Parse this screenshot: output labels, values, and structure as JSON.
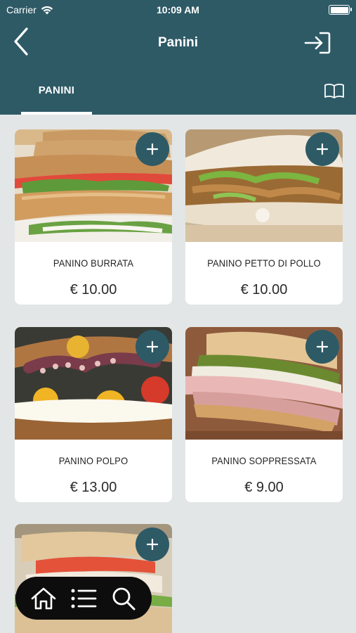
{
  "status_bar": {
    "carrier": "Carrier",
    "time": "10:09 AM"
  },
  "header": {
    "title": "Panini"
  },
  "tabs": [
    {
      "label": "PANINI",
      "active": true
    }
  ],
  "products": [
    {
      "name": "PANINO BURRATA",
      "price": "€ 10.00"
    },
    {
      "name": "PANINO PETTO DI POLLO",
      "price": "€ 10.00"
    },
    {
      "name": "PANINO POLPO",
      "price": "€ 13.00"
    },
    {
      "name": "PANINO SOPPRESSATA",
      "price": "€ 9.00"
    },
    {
      "name": "",
      "price": ""
    }
  ],
  "bottom_nav": [
    {
      "icon": "home-icon"
    },
    {
      "icon": "list-icon"
    },
    {
      "icon": "search-icon"
    }
  ],
  "colors": {
    "header": "#2e5a66",
    "background": "#e3e6e6",
    "card": "#ffffff",
    "bottom_bar": "#0d0d0d"
  }
}
